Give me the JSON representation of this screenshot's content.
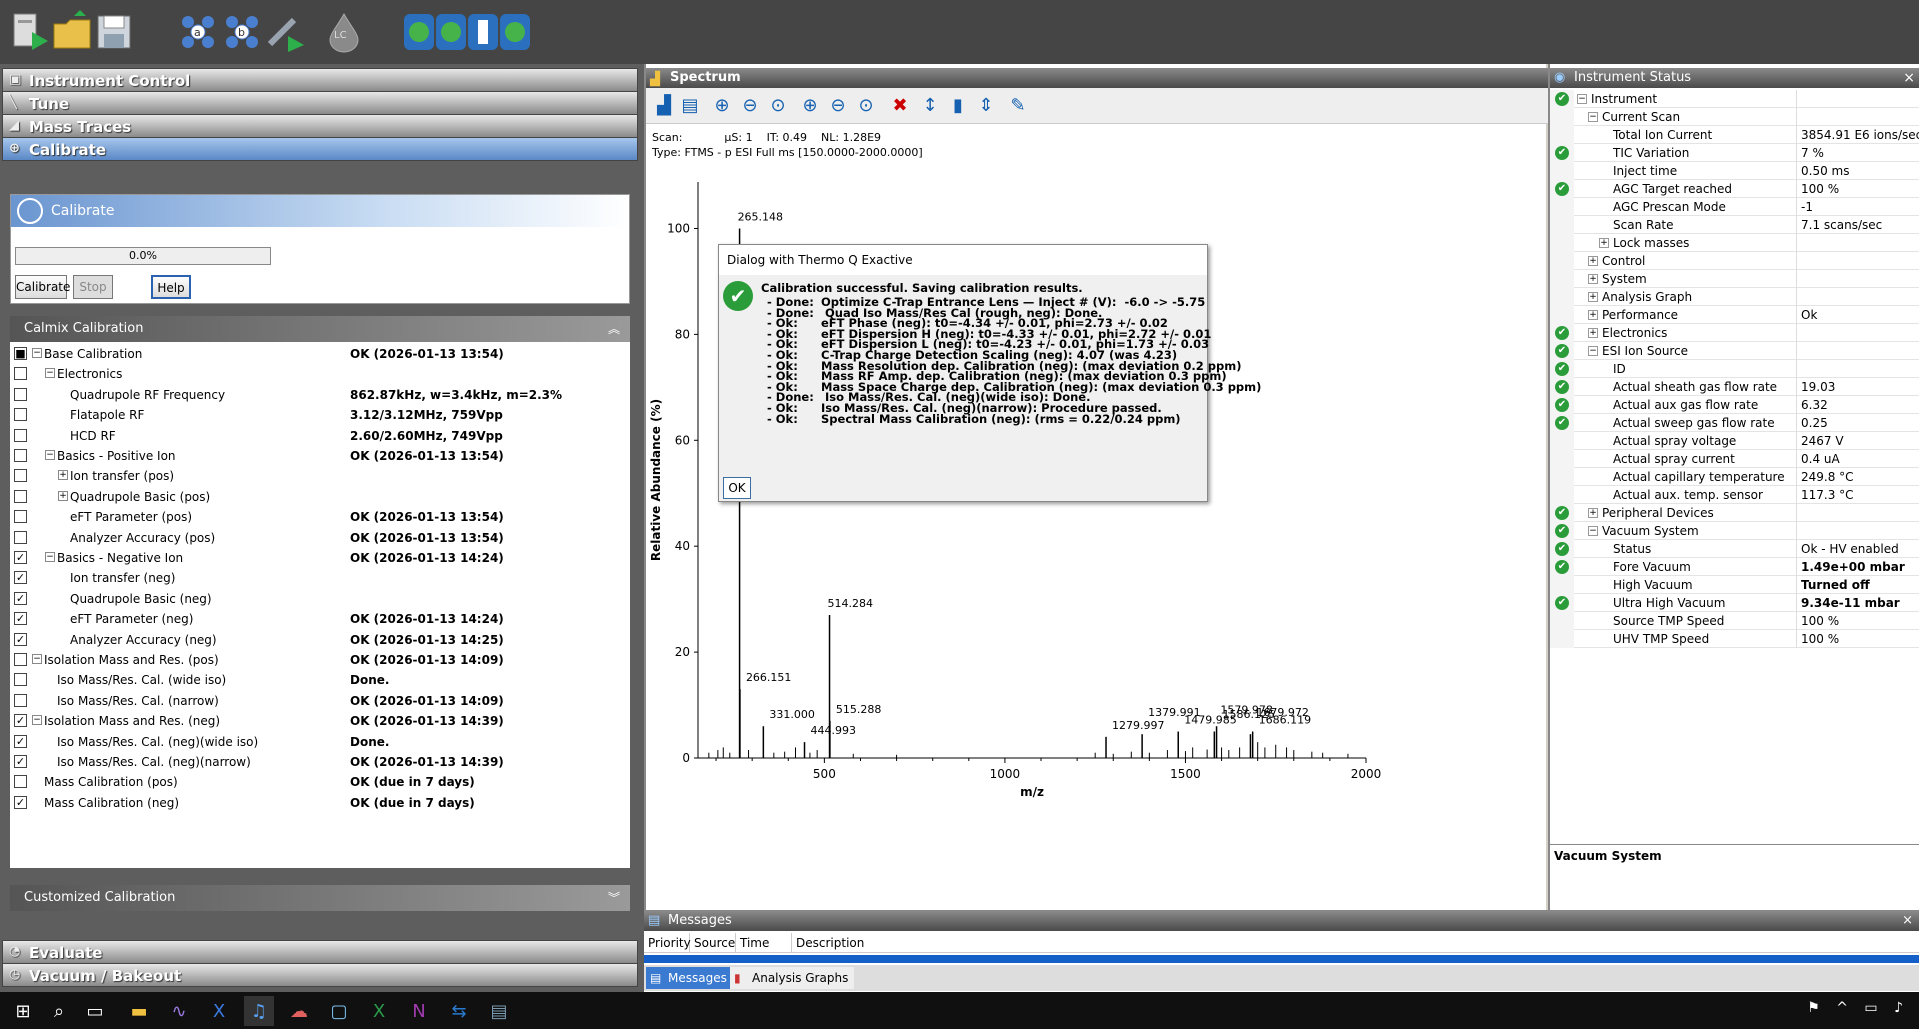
{
  "toolbar": {
    "icons": [
      "open-method-icon",
      "open-folder-icon",
      "save-icon",
      "sample-a-icon",
      "sample-b-icon",
      "syringe-icon",
      "lc-drop-icon",
      "ocp-icon-1",
      "ocp-icon-2",
      "ocp-icon-3",
      "ocp-icon-4"
    ],
    "lc_label": "LC"
  },
  "nav": {
    "instrument_control": "Instrument Control",
    "tune": "Tune",
    "mass_traces": "Mass Traces",
    "calibrate": "Calibrate",
    "evaluate": "Evaluate",
    "vacuum_bakeout": "Vacuum / Bakeout"
  },
  "calibrate_panel": {
    "title": "Calibrate",
    "progress": "0.0%",
    "calibrate_button": "Calibrate",
    "stop_button": "Stop",
    "help_button": "Help"
  },
  "calmix": {
    "header": "Calmix Calibration",
    "rows": [
      {
        "name": "Base Calibration",
        "status": "OK  (2026-01-13 13:54)",
        "checked": "partial",
        "level": 0,
        "expander": "−"
      },
      {
        "name": "Electronics",
        "status": "",
        "checked": "no",
        "level": 1,
        "expander": "−"
      },
      {
        "name": "Quadrupole RF Frequency",
        "status": "862.87kHz, w=3.4kHz, m=2.3%",
        "checked": "no",
        "level": 2,
        "expander": ""
      },
      {
        "name": "Flatapole RF",
        "status": "3.12/3.12MHz, 759Vpp",
        "checked": "no",
        "level": 2,
        "expander": ""
      },
      {
        "name": "HCD RF",
        "status": "2.60/2.60MHz, 749Vpp",
        "checked": "no",
        "level": 2,
        "expander": ""
      },
      {
        "name": "Basics - Positive Ion",
        "status": "OK  (2026-01-13 13:54)",
        "checked": "no",
        "level": 1,
        "expander": "−"
      },
      {
        "name": "Ion transfer (pos)",
        "status": "",
        "checked": "no",
        "level": 2,
        "expander": "+"
      },
      {
        "name": "Quadrupole Basic (pos)",
        "status": "",
        "checked": "no",
        "level": 2,
        "expander": "+"
      },
      {
        "name": "eFT Parameter (pos)",
        "status": "OK  (2026-01-13 13:54)",
        "checked": "no",
        "level": 2,
        "expander": ""
      },
      {
        "name": "Analyzer Accuracy (pos)",
        "status": "OK  (2026-01-13 13:54)",
        "checked": "no",
        "level": 2,
        "expander": ""
      },
      {
        "name": "Basics - Negative Ion",
        "status": "OK  (2026-01-13 14:24)",
        "checked": "yes",
        "level": 1,
        "expander": "−"
      },
      {
        "name": "Ion transfer (neg)",
        "status": "",
        "checked": "yes",
        "level": 2,
        "expander": ""
      },
      {
        "name": "Quadrupole Basic (neg)",
        "status": "",
        "checked": "yes",
        "level": 2,
        "expander": ""
      },
      {
        "name": "eFT Parameter (neg)",
        "status": "OK  (2026-01-13 14:24)",
        "checked": "yes",
        "level": 2,
        "expander": ""
      },
      {
        "name": "Analyzer Accuracy (neg)",
        "status": "OK  (2026-01-13 14:25)",
        "checked": "yes",
        "level": 2,
        "expander": ""
      },
      {
        "name": "Isolation Mass and Res. (pos)",
        "status": "OK  (2026-01-13 14:09)",
        "checked": "no",
        "level": 0,
        "expander": "−"
      },
      {
        "name": "Iso Mass/Res. Cal. (wide iso)",
        "status": "Done.",
        "checked": "no",
        "level": 1,
        "expander": ""
      },
      {
        "name": "Iso Mass/Res. Cal. (narrow)",
        "status": "OK  (2026-01-13 14:09)",
        "checked": "no",
        "level": 1,
        "expander": ""
      },
      {
        "name": "Isolation Mass and Res. (neg)",
        "status": "OK  (2026-01-13 14:39)",
        "checked": "yes",
        "level": 0,
        "expander": "−"
      },
      {
        "name": "Iso Mass/Res. Cal. (neg)(wide iso)",
        "status": "Done.",
        "checked": "yes",
        "level": 1,
        "expander": ""
      },
      {
        "name": "Iso Mass/Res. Cal. (neg)(narrow)",
        "status": "OK  (2026-01-13 14:39)",
        "checked": "yes",
        "level": 1,
        "expander": ""
      },
      {
        "name": "Mass Calibration (pos)",
        "status": "OK  (due in 7 days)",
        "checked": "no",
        "level": 0,
        "expander": ""
      },
      {
        "name": "Mass Calibration (neg)",
        "status": "OK  (due in 7 days)",
        "checked": "yes",
        "level": 0,
        "expander": ""
      }
    ]
  },
  "customized": {
    "header": "Customized Calibration"
  },
  "spectrum": {
    "title": "Spectrum",
    "scan_line": "Scan:            µS: 1    IT: 0.49    NL: 1.28E9",
    "type_line": "Type: FTMS - p ESI Full ms [150.0000-2000.0000]",
    "tool_icons": [
      "chart-icon",
      "print-icon",
      "zoom-in-icon",
      "zoom-out-icon",
      "zoom-reset-icon",
      "zoom-x-in-icon",
      "zoom-x-out-icon",
      "zoom-x-icon",
      "cancel-zoom-icon",
      "scale-100-icon",
      "scale-100-bar-icon",
      "scale-100-y-icon",
      "pin-icon"
    ]
  },
  "chart_data": {
    "type": "bar",
    "xlabel": "m/z",
    "ylabel": "Relative Abundance (%)",
    "xlim": [
      150,
      2000
    ],
    "ylim": [
      0,
      105
    ],
    "xticks": [
      "500",
      "1000",
      "1500",
      "2000"
    ],
    "yticks": [
      "0",
      "20",
      "40",
      "60",
      "80",
      "100"
    ],
    "peaks": [
      {
        "x": 265.148,
        "y": 100,
        "label": "265.148"
      },
      {
        "x": 266.151,
        "y": 13,
        "label": "266.151"
      },
      {
        "x": 331.0,
        "y": 6,
        "label": "331.000"
      },
      {
        "x": 444.993,
        "y": 3,
        "label": "444.993"
      },
      {
        "x": 514.284,
        "y": 27,
        "label": "514.284"
      },
      {
        "x": 515.288,
        "y": 7,
        "label": "515.288"
      },
      {
        "x": 1279.997,
        "y": 4,
        "label": "1279.997"
      },
      {
        "x": 1379.991,
        "y": 4.5,
        "label": "1379.991"
      },
      {
        "x": 1479.985,
        "y": 5,
        "label": "1479.985"
      },
      {
        "x": 1579.978,
        "y": 5,
        "label": "1579.978"
      },
      {
        "x": 1586.125,
        "y": 6,
        "label": "1586.125"
      },
      {
        "x": 1679.972,
        "y": 4.5,
        "label": "1679.972"
      },
      {
        "x": 1686.119,
        "y": 5,
        "label": "1686.119"
      }
    ],
    "minor_peaks": [
      {
        "x": 180,
        "y": 1
      },
      {
        "x": 205,
        "y": 1.5
      },
      {
        "x": 220,
        "y": 2
      },
      {
        "x": 238,
        "y": 1
      },
      {
        "x": 290,
        "y": 1.5
      },
      {
        "x": 360,
        "y": 1
      },
      {
        "x": 390,
        "y": 1.2
      },
      {
        "x": 420,
        "y": 2
      },
      {
        "x": 460,
        "y": 1
      },
      {
        "x": 480,
        "y": 1.5
      },
      {
        "x": 580,
        "y": 0.8
      },
      {
        "x": 700,
        "y": 0.6
      },
      {
        "x": 1250,
        "y": 1
      },
      {
        "x": 1300,
        "y": 0.8
      },
      {
        "x": 1350,
        "y": 1.2
      },
      {
        "x": 1400,
        "y": 1
      },
      {
        "x": 1450,
        "y": 1.5
      },
      {
        "x": 1500,
        "y": 1.3
      },
      {
        "x": 1520,
        "y": 2
      },
      {
        "x": 1560,
        "y": 1.6
      },
      {
        "x": 1600,
        "y": 2
      },
      {
        "x": 1620,
        "y": 1.5
      },
      {
        "x": 1650,
        "y": 2
      },
      {
        "x": 1700,
        "y": 3
      },
      {
        "x": 1720,
        "y": 2
      },
      {
        "x": 1750,
        "y": 2.5
      },
      {
        "x": 1780,
        "y": 2
      },
      {
        "x": 1800,
        "y": 1.5
      },
      {
        "x": 1850,
        "y": 1.2
      },
      {
        "x": 1880,
        "y": 1
      },
      {
        "x": 1950,
        "y": 0.8
      }
    ]
  },
  "dialog": {
    "title": "Dialog with Thermo Q Exactive",
    "main": "Calibration successful. Saving calibration results.",
    "lines": [
      {
        "k": "- Done:",
        "v": "Optimize C-Trap Entrance Lens — Inject # (V):  -6.0 -> -5.75"
      },
      {
        "k": "- Done:",
        "v": " Quad Iso Mass/Res Cal (rough, neg): Done."
      },
      {
        "k": "- Ok:",
        "v": "eFT Phase (neg): t0=-4.34 +/- 0.01, phi=2.73 +/- 0.02"
      },
      {
        "k": "- Ok:",
        "v": "eFT Dispersion H (neg): t0=-4.33 +/- 0.01, phi=2.72 +/- 0.01"
      },
      {
        "k": "- Ok:",
        "v": "eFT Dispersion L (neg): t0=-4.23 +/- 0.01, phi=1.73 +/- 0.03"
      },
      {
        "k": "- Ok:",
        "v": "C-Trap Charge Detection Scaling (neg): 4.07 (was 4.23)"
      },
      {
        "k": "- Ok:",
        "v": "Mass Resolution dep. Calibration (neg): (max deviation 0.2 ppm)"
      },
      {
        "k": "- Ok:",
        "v": "Mass RF Amp. dep. Calibration (neg): (max deviation 0.3 ppm)"
      },
      {
        "k": "- Ok:",
        "v": "Mass Space Charge dep. Calibration (neg): (max deviation 0.3 ppm)"
      },
      {
        "k": "- Done:",
        "v": " Iso Mass/Res. Cal. (neg)(wide iso): Done."
      },
      {
        "k": "- Ok:",
        "v": "Iso Mass/Res. Cal. (neg)(narrow): Procedure passed."
      },
      {
        "k": "- Ok:",
        "v": "Spectral Mass Calibration (neg): (rms = 0.22/0.24 ppm)"
      }
    ],
    "ok_button": "OK"
  },
  "status": {
    "title": "Instrument Status",
    "close": "×",
    "rows": [
      {
        "label": "Instrument",
        "value": "",
        "ok": true,
        "indent": 1,
        "toggle": "−",
        "bold": false
      },
      {
        "label": "Current Scan",
        "value": "",
        "ok": false,
        "indent": 2,
        "toggle": "−",
        "bold": false
      },
      {
        "label": "Total Ion Current",
        "value": "3854.91 E6 ions/sec",
        "ok": false,
        "indent": 3,
        "toggle": "",
        "bold": false
      },
      {
        "label": "TIC Variation",
        "value": "7 %",
        "ok": true,
        "indent": 3,
        "toggle": "",
        "bold": false
      },
      {
        "label": "Inject time",
        "value": "0.50 ms",
        "ok": false,
        "indent": 3,
        "toggle": "",
        "bold": false
      },
      {
        "label": "AGC Target reached",
        "value": "100 %",
        "ok": true,
        "indent": 3,
        "toggle": "",
        "bold": false
      },
      {
        "label": "AGC Prescan Mode",
        "value": "-1",
        "ok": false,
        "indent": 3,
        "toggle": "",
        "bold": false
      },
      {
        "label": "Scan Rate",
        "value": "7.1 scans/sec",
        "ok": false,
        "indent": 3,
        "toggle": "",
        "bold": false
      },
      {
        "label": "Lock masses",
        "value": "",
        "ok": false,
        "indent": 3,
        "toggle": "+",
        "bold": false
      },
      {
        "label": "Control",
        "value": "",
        "ok": false,
        "indent": 2,
        "toggle": "+",
        "bold": false
      },
      {
        "label": "System",
        "value": "",
        "ok": false,
        "indent": 2,
        "toggle": "+",
        "bold": false
      },
      {
        "label": "Analysis Graph",
        "value": "",
        "ok": false,
        "indent": 2,
        "toggle": "+",
        "bold": false
      },
      {
        "label": "Performance",
        "value": "Ok",
        "ok": false,
        "indent": 2,
        "toggle": "+",
        "bold": false
      },
      {
        "label": "Electronics",
        "value": "",
        "ok": true,
        "indent": 2,
        "toggle": "+",
        "bold": false
      },
      {
        "label": "ESI Ion Source",
        "value": "",
        "ok": true,
        "indent": 2,
        "toggle": "−",
        "bold": false
      },
      {
        "label": "ID",
        "value": "",
        "ok": true,
        "indent": 3,
        "toggle": "",
        "bold": false
      },
      {
        "label": "Actual sheath gas flow rate",
        "value": "19.03",
        "ok": true,
        "indent": 3,
        "toggle": "",
        "bold": false
      },
      {
        "label": "Actual aux gas flow rate",
        "value": "6.32",
        "ok": true,
        "indent": 3,
        "toggle": "",
        "bold": false
      },
      {
        "label": "Actual sweep gas flow rate",
        "value": "0.25",
        "ok": true,
        "indent": 3,
        "toggle": "",
        "bold": false
      },
      {
        "label": "Actual spray voltage",
        "value": "2467 V",
        "ok": false,
        "indent": 3,
        "toggle": "",
        "bold": false
      },
      {
        "label": "Actual spray current",
        "value": "0.4 uA",
        "ok": false,
        "indent": 3,
        "toggle": "",
        "bold": false
      },
      {
        "label": "Actual capillary temperature",
        "value": "249.8 °C",
        "ok": false,
        "indent": 3,
        "toggle": "",
        "bold": false
      },
      {
        "label": "Actual aux. temp. sensor",
        "value": "117.3 °C",
        "ok": false,
        "indent": 3,
        "toggle": "",
        "bold": false
      },
      {
        "label": "Peripheral Devices",
        "value": "",
        "ok": true,
        "indent": 2,
        "toggle": "+",
        "bold": false
      },
      {
        "label": "Vacuum System",
        "value": "",
        "ok": true,
        "indent": 2,
        "toggle": "−",
        "bold": false
      },
      {
        "label": "Status",
        "value": "Ok - HV enabled",
        "ok": true,
        "indent": 3,
        "toggle": "",
        "bold": false
      },
      {
        "label": "Fore Vacuum",
        "value": "1.49e+00 mbar",
        "ok": true,
        "indent": 3,
        "toggle": "",
        "bold": true
      },
      {
        "label": "High Vacuum",
        "value": "Turned off",
        "ok": false,
        "indent": 3,
        "toggle": "",
        "bold": true
      },
      {
        "label": "Ultra High Vacuum",
        "value": "9.34e-11 mbar",
        "ok": true,
        "indent": 3,
        "toggle": "",
        "bold": true
      },
      {
        "label": "Source TMP Speed",
        "value": "100 %",
        "ok": false,
        "indent": 3,
        "toggle": "",
        "bold": false
      },
      {
        "label": "UHV TMP Speed",
        "value": "100 %",
        "ok": false,
        "indent": 3,
        "toggle": "",
        "bold": false
      }
    ],
    "section_label": "Vacuum System"
  },
  "messages": {
    "title": "Messages",
    "close": "×",
    "cols": [
      "Priority",
      "Source",
      "Time",
      "Description"
    ],
    "tab_messages": "Messages",
    "tab_graphs": "Analysis Graphs"
  },
  "taskbar": {
    "icons": [
      "windows-start-icon",
      "search-icon",
      "task-view-icon",
      "file-explorer-icon",
      "app-wave-icon",
      "app-x-icon",
      "music-icon",
      "app-cloud-icon",
      "app-doc-icon",
      "excel-icon",
      "onenote-icon",
      "teamviewer-icon",
      "app-monitor-icon"
    ]
  }
}
